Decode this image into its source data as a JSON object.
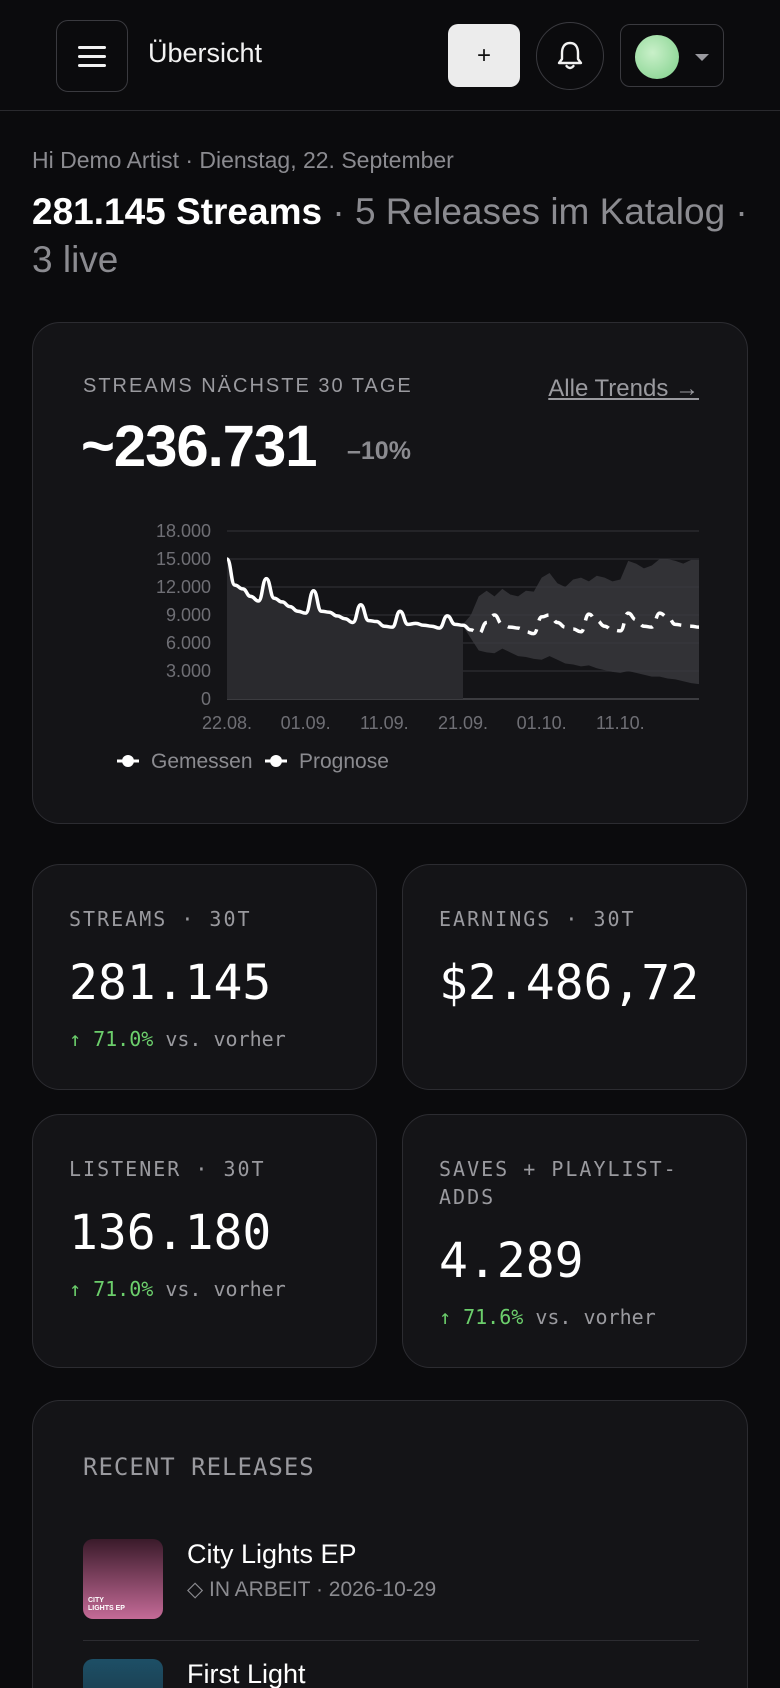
{
  "header": {
    "title": "Übersicht",
    "add_label": "+",
    "icons": {
      "menu": "menu-icon",
      "bell": "bell-icon",
      "caret": "chevron-down-icon"
    }
  },
  "greeting": {
    "line": "Hi Demo Artist · Dienstag, 22. September",
    "streams": "281.145 Streams",
    "rest": " · 5 Releases im Katalog · 3 live"
  },
  "trend": {
    "label": "STREAMS NÄCHSTE 30 TAGE",
    "link": "Alle Trends →",
    "value": "~236.731",
    "delta": "–10%",
    "legend": [
      "Gemessen",
      "Prognose"
    ]
  },
  "chart_data": {
    "type": "line",
    "title": "",
    "xlabel": "",
    "ylabel": "",
    "ylim": [
      0,
      18000
    ],
    "y_ticks": [
      "18.000",
      "15.000",
      "12.000",
      "9.000",
      "6.000",
      "3.000",
      "0"
    ],
    "x_ticks": [
      "22.08.",
      "01.09.",
      "11.09.",
      "21.09.",
      "01.10.",
      "11.10."
    ],
    "grid": true,
    "legend_position": "bottom-left",
    "series": [
      {
        "name": "Gemessen",
        "style": "solid",
        "x": [
          0,
          1,
          2,
          3,
          4,
          5,
          6,
          7,
          8,
          9,
          10,
          11,
          12,
          13,
          14,
          15,
          16,
          17,
          18,
          19,
          20,
          21,
          22,
          23,
          24,
          25,
          26,
          27,
          28,
          29,
          30
        ],
        "values": [
          15000,
          12200,
          11800,
          11000,
          10500,
          12900,
          10800,
          10400,
          9900,
          9400,
          9200,
          11600,
          9400,
          9300,
          8900,
          8600,
          8200,
          10100,
          8400,
          8300,
          7800,
          7700,
          9400,
          8000,
          8100,
          7900,
          7800,
          7600,
          8900,
          8000,
          7900
        ]
      },
      {
        "name": "Prognose",
        "style": "dashed",
        "x": [
          30,
          31,
          32,
          33,
          34,
          35,
          36,
          37,
          38,
          39,
          40,
          41,
          42,
          43,
          44,
          45,
          46,
          47,
          48,
          49,
          50,
          51,
          52,
          53,
          54,
          55,
          56,
          57,
          58,
          59,
          60
        ],
        "values": [
          7900,
          7400,
          7000,
          8200,
          9000,
          8000,
          7700,
          7600,
          7200,
          7000,
          8800,
          9000,
          8200,
          7700,
          7500,
          7200,
          9100,
          8400,
          7800,
          7400,
          7300,
          9200,
          8500,
          7800,
          7700,
          9200,
          8800,
          8000,
          7900,
          7800,
          7700
        ],
        "band_upper": [
          8000,
          9000,
          11000,
          11600,
          11000,
          11800,
          11200,
          11000,
          11600,
          11500,
          13000,
          13500,
          12400,
          12000,
          12800,
          13000,
          12600,
          13200,
          13000,
          12600,
          12800,
          14800,
          14500,
          14000,
          14300,
          15000,
          15000,
          14800,
          14500,
          14900,
          14900
        ],
        "band_lower": [
          7800,
          6500,
          5200,
          5000,
          4900,
          5400,
          5000,
          4600,
          4500,
          4300,
          4200,
          4600,
          4200,
          3800,
          3700,
          3500,
          3600,
          3300,
          3100,
          2900,
          2800,
          3000,
          2800,
          2600,
          2400,
          2400,
          2200,
          2100,
          1900,
          1700,
          1600
        ]
      }
    ]
  },
  "stats": [
    {
      "label": "STREAMS · 30T",
      "value": "281.145",
      "arrow": "↑",
      "pct": "71.0%",
      "suffix": " vs. vorher"
    },
    {
      "label": "EARNINGS · 30T",
      "value": "$2.486,72"
    },
    {
      "label": "LISTENER · 30T",
      "value": "136.180",
      "arrow": "↑",
      "pct": "71.0%",
      "suffix": " vs. vorher"
    },
    {
      "label": "SAVES + PLAYLIST-ADDS",
      "label_line1": "SAVES + PLAYLIST-",
      "label_line2": "ADDS",
      "value": "4.289",
      "arrow": "↑",
      "pct": "71.6%",
      "suffix": " vs. vorher"
    }
  ],
  "colors": {
    "accent_green": "#6ccf6c",
    "background": "#0b0b0d",
    "card": "#141417"
  },
  "releases": {
    "title": "RECENT RELEASES",
    "items": [
      {
        "name": "City Lights EP",
        "meta": "◇ IN ARBEIT · 2026-10-29",
        "cover_text_1": "CITY",
        "cover_text_2": "LIGHTS EP"
      },
      {
        "name": "First Light"
      }
    ]
  }
}
